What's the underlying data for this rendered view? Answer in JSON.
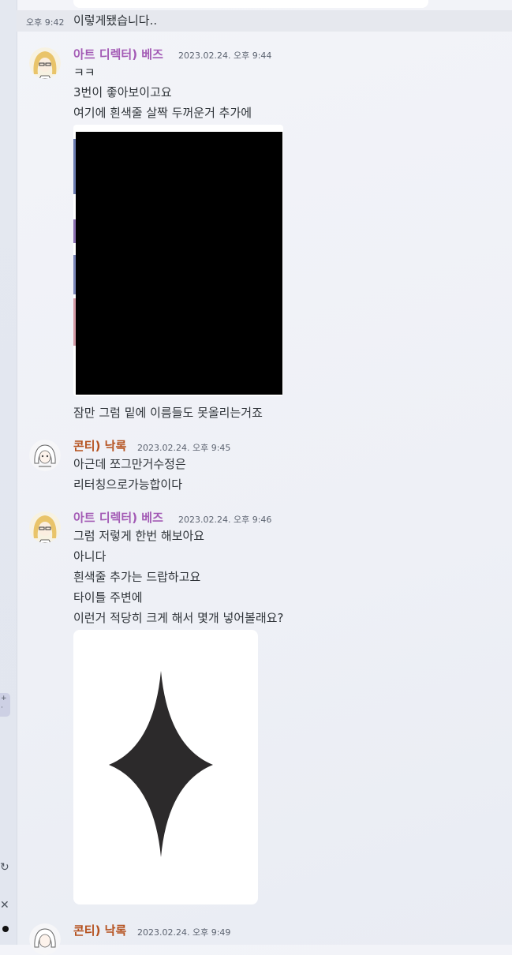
{
  "prev": {
    "time": "오후 9:42",
    "text": "이렇게됐습니다.."
  },
  "messages": [
    {
      "author": "아트 디렉터) 베즈",
      "timestamp": "2023.02.24. 오후 9:44",
      "lines": [
        "ㅋㅋ",
        "3번이 좋아보이고요",
        "여기에 흰색줄 살짝 두꺼운거 추가에"
      ],
      "after_image": "잠만 그럼 밑에 이름들도 못올리는거죠"
    },
    {
      "author": "콘티) 낙록",
      "timestamp": "2023.02.24. 오후 9:45",
      "lines": [
        "아근데 쪼그만거수정은",
        "리터칭으로가능합이다"
      ]
    },
    {
      "author": "아트 디렉터) 베즈",
      "timestamp": "2023.02.24. 오후 9:46",
      "lines": [
        "그럼 저렇게 한번 해보아요",
        "아니다",
        "흰색줄 추가는 드랍하고요",
        "타이틀 주변에",
        "이런거 적당히 크게 해서 몇개 넣어볼래요?"
      ]
    },
    {
      "author": "콘티) 낙록",
      "timestamp": "2023.02.24. 오후 9:49"
    }
  ],
  "colors": {
    "name_art_director": "#a35bb5",
    "name_conti": "#b5511e",
    "background": "#f0f2f7",
    "text": "#2e3338"
  },
  "icons": {
    "sidebar_add": "plus-icon",
    "sidebar_sync": "refresh-icon",
    "sidebar_close": "close-icon"
  }
}
